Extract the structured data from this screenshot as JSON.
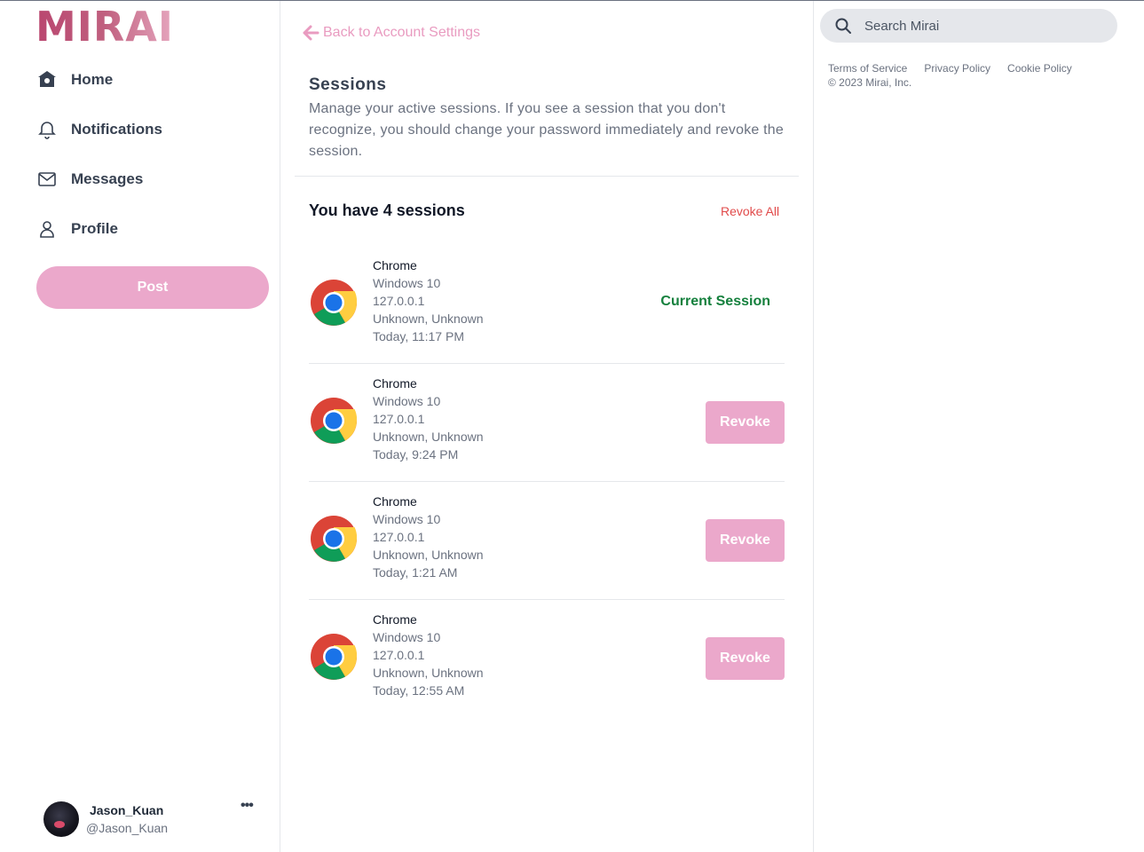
{
  "brand": {
    "logo_text": "MIRAI"
  },
  "sidebar": {
    "items": [
      {
        "label": "Home",
        "icon": "home-icon"
      },
      {
        "label": "Notifications",
        "icon": "bell-icon"
      },
      {
        "label": "Messages",
        "icon": "envelope-icon"
      },
      {
        "label": "Profile",
        "icon": "user-icon"
      }
    ],
    "post_label": "Post"
  },
  "user": {
    "name": "Jason_Kuan",
    "handle": "@Jason_Kuan",
    "more": "•••"
  },
  "main": {
    "back_label": "Back to Account Settings",
    "title": "Sessions",
    "description": "Manage your active sessions. If you see a session that you don't recognize, you should change your password immediately and revoke the session.",
    "count_title": "You have 4 sessions",
    "revoke_all": "Revoke All",
    "sessions": [
      {
        "browser": "Chrome",
        "os": "Windows 10",
        "ip": "127.0.0.1",
        "location": "Unknown, Unknown",
        "time": "Today, 11:17 PM",
        "status": "Current Session"
      },
      {
        "browser": "Chrome",
        "os": "Windows 10",
        "ip": "127.0.0.1",
        "location": "Unknown, Unknown",
        "time": "Today, 9:24 PM",
        "action": "Revoke"
      },
      {
        "browser": "Chrome",
        "os": "Windows 10",
        "ip": "127.0.0.1",
        "location": "Unknown, Unknown",
        "time": "Today, 1:21 AM",
        "action": "Revoke"
      },
      {
        "browser": "Chrome",
        "os": "Windows 10",
        "ip": "127.0.0.1",
        "location": "Unknown, Unknown",
        "time": "Today, 12:55 AM",
        "action": "Revoke"
      }
    ]
  },
  "right": {
    "search_placeholder": "Search Mirai",
    "links": [
      "Terms of Service",
      "Privacy Policy",
      "Cookie Policy"
    ],
    "copyright": "© 2023 Mirai, Inc."
  },
  "colors": {
    "accent": "#eba8cb",
    "link": "#e99bc0",
    "danger": "#e14b4b",
    "success": "#15803d"
  }
}
